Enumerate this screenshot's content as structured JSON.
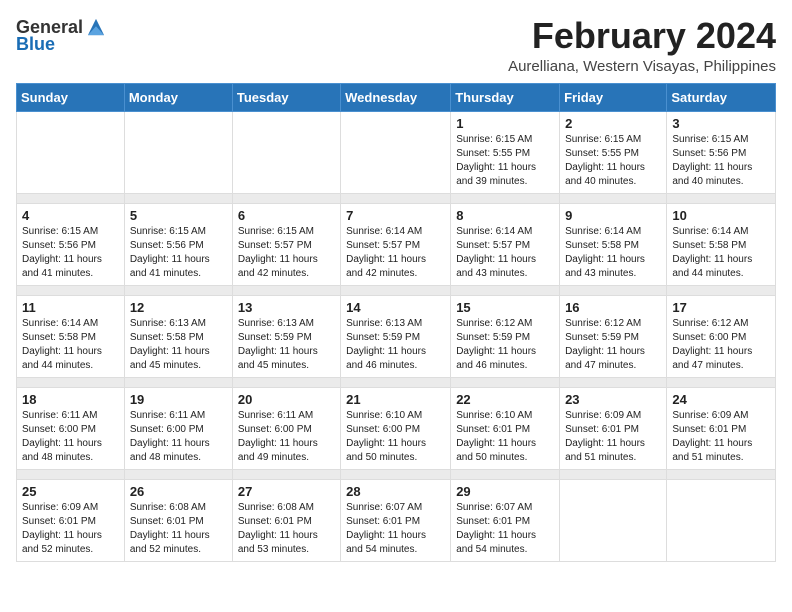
{
  "logo": {
    "general": "General",
    "blue": "Blue"
  },
  "title": {
    "month_year": "February 2024",
    "location": "Aurelliana, Western Visayas, Philippines"
  },
  "days_of_week": [
    "Sunday",
    "Monday",
    "Tuesday",
    "Wednesday",
    "Thursday",
    "Friday",
    "Saturday"
  ],
  "weeks": [
    {
      "days": [
        {
          "num": "",
          "info": ""
        },
        {
          "num": "",
          "info": ""
        },
        {
          "num": "",
          "info": ""
        },
        {
          "num": "",
          "info": ""
        },
        {
          "num": "1",
          "info": "Sunrise: 6:15 AM\nSunset: 5:55 PM\nDaylight: 11 hours\nand 39 minutes."
        },
        {
          "num": "2",
          "info": "Sunrise: 6:15 AM\nSunset: 5:55 PM\nDaylight: 11 hours\nand 40 minutes."
        },
        {
          "num": "3",
          "info": "Sunrise: 6:15 AM\nSunset: 5:56 PM\nDaylight: 11 hours\nand 40 minutes."
        }
      ]
    },
    {
      "days": [
        {
          "num": "4",
          "info": "Sunrise: 6:15 AM\nSunset: 5:56 PM\nDaylight: 11 hours\nand 41 minutes."
        },
        {
          "num": "5",
          "info": "Sunrise: 6:15 AM\nSunset: 5:56 PM\nDaylight: 11 hours\nand 41 minutes."
        },
        {
          "num": "6",
          "info": "Sunrise: 6:15 AM\nSunset: 5:57 PM\nDaylight: 11 hours\nand 42 minutes."
        },
        {
          "num": "7",
          "info": "Sunrise: 6:14 AM\nSunset: 5:57 PM\nDaylight: 11 hours\nand 42 minutes."
        },
        {
          "num": "8",
          "info": "Sunrise: 6:14 AM\nSunset: 5:57 PM\nDaylight: 11 hours\nand 43 minutes."
        },
        {
          "num": "9",
          "info": "Sunrise: 6:14 AM\nSunset: 5:58 PM\nDaylight: 11 hours\nand 43 minutes."
        },
        {
          "num": "10",
          "info": "Sunrise: 6:14 AM\nSunset: 5:58 PM\nDaylight: 11 hours\nand 44 minutes."
        }
      ]
    },
    {
      "days": [
        {
          "num": "11",
          "info": "Sunrise: 6:14 AM\nSunset: 5:58 PM\nDaylight: 11 hours\nand 44 minutes."
        },
        {
          "num": "12",
          "info": "Sunrise: 6:13 AM\nSunset: 5:58 PM\nDaylight: 11 hours\nand 45 minutes."
        },
        {
          "num": "13",
          "info": "Sunrise: 6:13 AM\nSunset: 5:59 PM\nDaylight: 11 hours\nand 45 minutes."
        },
        {
          "num": "14",
          "info": "Sunrise: 6:13 AM\nSunset: 5:59 PM\nDaylight: 11 hours\nand 46 minutes."
        },
        {
          "num": "15",
          "info": "Sunrise: 6:12 AM\nSunset: 5:59 PM\nDaylight: 11 hours\nand 46 minutes."
        },
        {
          "num": "16",
          "info": "Sunrise: 6:12 AM\nSunset: 5:59 PM\nDaylight: 11 hours\nand 47 minutes."
        },
        {
          "num": "17",
          "info": "Sunrise: 6:12 AM\nSunset: 6:00 PM\nDaylight: 11 hours\nand 47 minutes."
        }
      ]
    },
    {
      "days": [
        {
          "num": "18",
          "info": "Sunrise: 6:11 AM\nSunset: 6:00 PM\nDaylight: 11 hours\nand 48 minutes."
        },
        {
          "num": "19",
          "info": "Sunrise: 6:11 AM\nSunset: 6:00 PM\nDaylight: 11 hours\nand 48 minutes."
        },
        {
          "num": "20",
          "info": "Sunrise: 6:11 AM\nSunset: 6:00 PM\nDaylight: 11 hours\nand 49 minutes."
        },
        {
          "num": "21",
          "info": "Sunrise: 6:10 AM\nSunset: 6:00 PM\nDaylight: 11 hours\nand 50 minutes."
        },
        {
          "num": "22",
          "info": "Sunrise: 6:10 AM\nSunset: 6:01 PM\nDaylight: 11 hours\nand 50 minutes."
        },
        {
          "num": "23",
          "info": "Sunrise: 6:09 AM\nSunset: 6:01 PM\nDaylight: 11 hours\nand 51 minutes."
        },
        {
          "num": "24",
          "info": "Sunrise: 6:09 AM\nSunset: 6:01 PM\nDaylight: 11 hours\nand 51 minutes."
        }
      ]
    },
    {
      "days": [
        {
          "num": "25",
          "info": "Sunrise: 6:09 AM\nSunset: 6:01 PM\nDaylight: 11 hours\nand 52 minutes."
        },
        {
          "num": "26",
          "info": "Sunrise: 6:08 AM\nSunset: 6:01 PM\nDaylight: 11 hours\nand 52 minutes."
        },
        {
          "num": "27",
          "info": "Sunrise: 6:08 AM\nSunset: 6:01 PM\nDaylight: 11 hours\nand 53 minutes."
        },
        {
          "num": "28",
          "info": "Sunrise: 6:07 AM\nSunset: 6:01 PM\nDaylight: 11 hours\nand 54 minutes."
        },
        {
          "num": "29",
          "info": "Sunrise: 6:07 AM\nSunset: 6:01 PM\nDaylight: 11 hours\nand 54 minutes."
        },
        {
          "num": "",
          "info": ""
        },
        {
          "num": "",
          "info": ""
        }
      ]
    }
  ]
}
